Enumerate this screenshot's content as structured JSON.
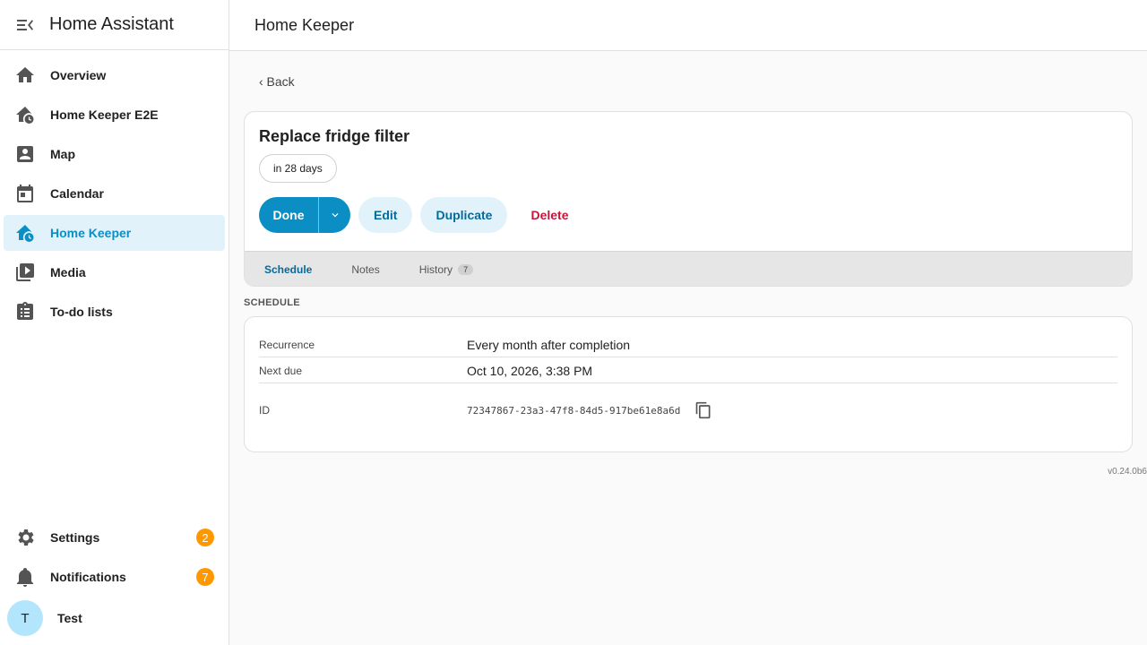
{
  "sidebar": {
    "title": "Home Assistant",
    "items": [
      {
        "label": "Overview",
        "icon": "home-icon"
      },
      {
        "label": "Home Keeper E2E",
        "icon": "home-clock-icon"
      },
      {
        "label": "Map",
        "icon": "map-icon"
      },
      {
        "label": "Calendar",
        "icon": "calendar-icon"
      },
      {
        "label": "Home Keeper",
        "icon": "home-clock-icon",
        "active": true
      },
      {
        "label": "Media",
        "icon": "media-icon"
      },
      {
        "label": "To-do lists",
        "icon": "todo-icon"
      }
    ],
    "bottom": {
      "settings": {
        "label": "Settings",
        "badge": "2"
      },
      "notifications": {
        "label": "Notifications",
        "badge": "7"
      },
      "user": {
        "initial": "T",
        "name": "Test"
      }
    }
  },
  "topbar": {
    "title": "Home Keeper"
  },
  "page": {
    "back_label": "‹ Back",
    "task": {
      "title": "Replace fridge filter",
      "due_chip": "in 28 days",
      "buttons": {
        "done": "Done",
        "edit": "Edit",
        "duplicate": "Duplicate",
        "delete": "Delete"
      }
    },
    "tabs": [
      {
        "label": "Schedule",
        "active": true
      },
      {
        "label": "Notes"
      },
      {
        "label": "History",
        "count": "7"
      }
    ],
    "section_label": "SCHEDULE",
    "schedule": {
      "recurrence_label": "Recurrence",
      "recurrence_value": "Every month after completion",
      "next_due_label": "Next due",
      "next_due_value": "Oct 10, 2026, 3:38 PM",
      "id_label": "ID",
      "id_value": "72347867-23a3-47f8-84d5-917be61e8a6d"
    },
    "version": "v0.24.0b6"
  },
  "colors": {
    "accent": "#0b8ec4",
    "active_bg": "#e1f2fa",
    "danger": "#c4163a",
    "badge": "#ff9800"
  }
}
